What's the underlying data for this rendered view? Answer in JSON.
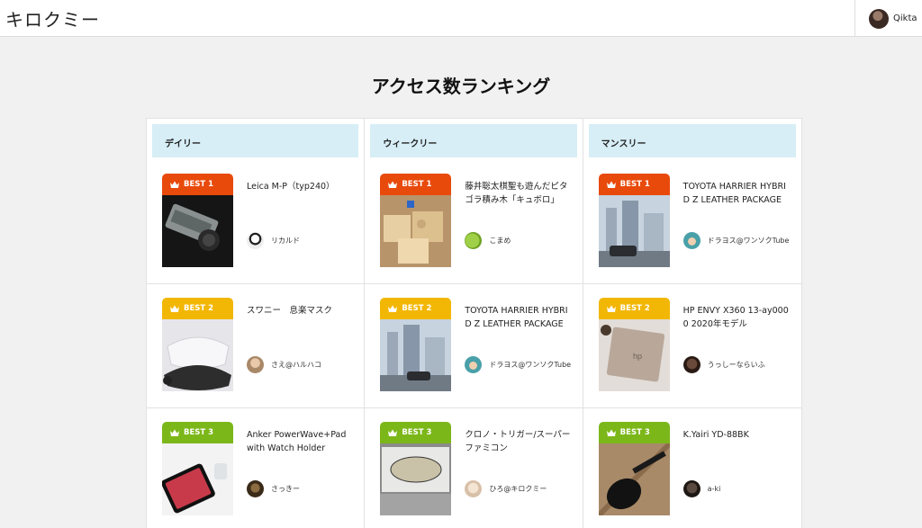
{
  "header": {
    "site_title": "キロクミー",
    "user_name": "Qikta"
  },
  "page_title": "アクセス数ランキング",
  "columns": [
    {
      "label": "デイリー",
      "items": [
        {
          "badge": "BEST 1",
          "title": "Leica M-P（typ240）",
          "author": "リカルド",
          "badge_color": "#e84a0c"
        },
        {
          "badge": "BEST 2",
          "title": "スワニー　息楽マスク",
          "author": "さえ@ハルハコ",
          "badge_color": "#f2b705"
        },
        {
          "badge": "BEST 3",
          "title": "Anker PowerWave+Pad with Watch Holder",
          "author": "さっきー",
          "badge_color": "#7cb71a"
        }
      ]
    },
    {
      "label": "ウィークリー",
      "items": [
        {
          "badge": "BEST 1",
          "title": "藤井聡太棋聖も遊んだピタゴラ積み木「キュボロ」",
          "author": "こまめ",
          "badge_color": "#e84a0c"
        },
        {
          "badge": "BEST 2",
          "title": "TOYOTA HARRIER HYBRID Z LEATHER PACKAGE",
          "author": "ドラヨス@ワンソクTube",
          "badge_color": "#f2b705"
        },
        {
          "badge": "BEST 3",
          "title": "クロノ・トリガー/スーパーファミコン",
          "author": "ひろ@キロクミー",
          "badge_color": "#7cb71a"
        }
      ]
    },
    {
      "label": "マンスリー",
      "items": [
        {
          "badge": "BEST 1",
          "title": "TOYOTA HARRIER HYBRID Z LEATHER PACKAGE",
          "author": "ドラヨス@ワンソクTube",
          "badge_color": "#e84a0c"
        },
        {
          "badge": "BEST 2",
          "title": "HP ENVY X360 13-ay0000 2020年モデル",
          "author": "うっしーならいふ",
          "badge_color": "#f2b705"
        },
        {
          "badge": "BEST 3",
          "title": "K.Yairi YD-88BK",
          "author": "a-ki",
          "badge_color": "#7cb71a"
        }
      ]
    }
  ],
  "icons": {
    "crown": "crown-icon"
  }
}
